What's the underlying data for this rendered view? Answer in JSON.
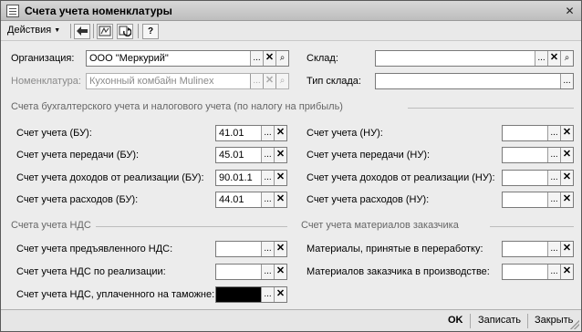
{
  "window": {
    "title": "Счета учета номенклатуры"
  },
  "titlebar_buttons": {
    "close": "✕"
  },
  "toolbar": {
    "actions_label": "Действия",
    "help_label": "?"
  },
  "header": {
    "org_label": "Организация:",
    "org_value": "ООО \"Меркурий\"",
    "nom_label": "Номенклатура:",
    "nom_value": "Кухонный комбайн Mulinex",
    "warehouse_label": "Склад:",
    "warehouse_value": "",
    "warehouse_type_label": "Тип склада:",
    "warehouse_type_value": ""
  },
  "sections": {
    "accounting": "Счета бухгалтерского учета и налогового учета (по налогу на прибыль)",
    "vat": "Счета учета НДС",
    "customer_materials": "Счет учета материалов заказчика"
  },
  "bu": [
    {
      "label": "Счет учета (БУ):",
      "value": "41.01"
    },
    {
      "label": "Счет учета передачи (БУ):",
      "value": "45.01"
    },
    {
      "label": "Счет учета доходов от реализации (БУ):",
      "value": "90.01.1"
    },
    {
      "label": "Счет учета расходов (БУ):",
      "value": "44.01"
    }
  ],
  "nu": [
    {
      "label": "Счет учета (НУ):",
      "value": ""
    },
    {
      "label": "Счет учета передачи (НУ):",
      "value": ""
    },
    {
      "label": "Счет учета доходов от реализации (НУ):",
      "value": ""
    },
    {
      "label": "Счет учета расходов (НУ):",
      "value": ""
    }
  ],
  "vat": [
    {
      "label": "Счет учета предъявленного НДС:",
      "value": ""
    },
    {
      "label": "Счет учета НДС по реализации:",
      "value": ""
    },
    {
      "label": "Счет учета НДС, уплаченного на таможне:",
      "value": ""
    }
  ],
  "materials": [
    {
      "label": "Материалы, принятые в переработку:",
      "value": ""
    },
    {
      "label": "Материалов заказчика в производстве:",
      "value": ""
    }
  ],
  "icons": {
    "select": "...",
    "clear": "✕",
    "open": "⌕"
  },
  "footer": {
    "ok": "OK",
    "save": "Записать",
    "close": "Закрыть"
  },
  "colors": {
    "window_bg": "#ececec",
    "title_bg": "#c8c8c8"
  }
}
